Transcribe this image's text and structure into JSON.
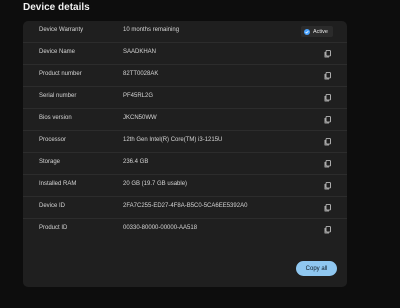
{
  "page_title": "Device details",
  "warranty": {
    "label": "Device Warranty",
    "value": "10 months remaining",
    "badge": "Active"
  },
  "rows": [
    {
      "label": "Device Name",
      "value": "SAADKHAN"
    },
    {
      "label": "Product number",
      "value": "82TT0028AK"
    },
    {
      "label": "Serial number",
      "value": "PF45RL2G"
    },
    {
      "label": "Bios version",
      "value": "JKCN50WW"
    },
    {
      "label": "Processor",
      "value": "12th Gen Intel(R) Core(TM) i3-1215U"
    },
    {
      "label": "Storage",
      "value": "236.4 GB"
    },
    {
      "label": "Installed RAM",
      "value": "20 GB (19.7 GB usable)"
    },
    {
      "label": "Device ID",
      "value": "2FA7C255-ED27-4F8A-B5C0-5CA6EE5392A0"
    },
    {
      "label": "Product ID",
      "value": "00330-80000-00000-AA518"
    }
  ],
  "copy_all_label": "Copy all",
  "colors": {
    "background": "#0d0d0d",
    "panel": "#1f1f1f",
    "accent": "#8fc7f0",
    "badge_dot": "#4aa3ff"
  },
  "icons": {
    "row_action": "copy-icon",
    "badge": "check-circle-icon"
  }
}
